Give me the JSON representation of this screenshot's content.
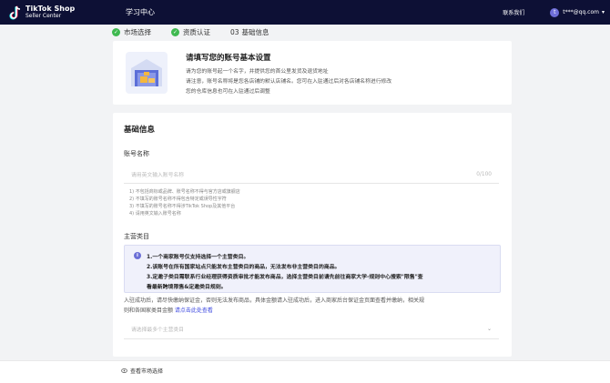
{
  "header": {
    "logo_line1": "TikTok Shop",
    "logo_line2": "Seller Center",
    "nav_title": "学习中心",
    "contact": "联系我们",
    "avatar_initial": "t",
    "email": "t***@qq.com"
  },
  "steps": [
    {
      "label": "市场选择",
      "status": "done"
    },
    {
      "label": "资质认证",
      "status": "done"
    },
    {
      "number": "03",
      "label": "基础信息",
      "status": "current"
    }
  ],
  "intro": {
    "title": "请填写您的账号基本设置",
    "line1": "请为您的账号起一个名字，并提供您的首公里发货及退货地址",
    "line2": "请注意，账号名称将是您各店铺的默认店铺名。您可在入驻通过后对各店铺名称进行修改",
    "line3": "您的仓库信息也可在入驻通过后调整"
  },
  "form": {
    "section_title": "基础信息",
    "account_name_label": "账号名称",
    "account_name_placeholder": "请用英文输入账号名称",
    "counter": "0/100",
    "rules": [
      "1) 不包括商标或品牌、账号名称不得与官方店或旗舰店",
      "2) 不填写的账号名称不得包含特定或误导性字符",
      "3) 不填写的账号名称不得涉TikTok Shop及其他平台",
      "4) 请用英文输入账号名称"
    ],
    "main_category_label": "主营类目",
    "notes": [
      "1.一个商家账号仅支持选择一个主营类目。",
      "2.该账号在所有国家站点只能发布主营类目的商品，无法发布非主营类目的商品。",
      "3.定邀子类目需联系行业经理获得资质审批才能发布商品，选择主营类目前请先前往商家大学-规则中心搜索\"限售\"查",
      "看最新跨境限售&定邀类目规则。"
    ],
    "desc_line1": "入驻成功后，请尽快缴纳保证金，否则无法发布商品，具体金额请入驻成功后，进入商家后台保证金页面查看并缴纳，相关规",
    "desc_line2_prefix": "则和各国家类目金额 ",
    "desc_link": "请点击此处查看",
    "category_placeholder": "请选择最多个主营类目"
  },
  "footer": {
    "view_market_label": "查看市场选择"
  },
  "colors": {
    "header_bg": "#0d1035",
    "success": "#3fb950",
    "accent": "#3e4ae0",
    "note_bg": "#f0f1fb",
    "info_icon": "#6b6fd6"
  }
}
